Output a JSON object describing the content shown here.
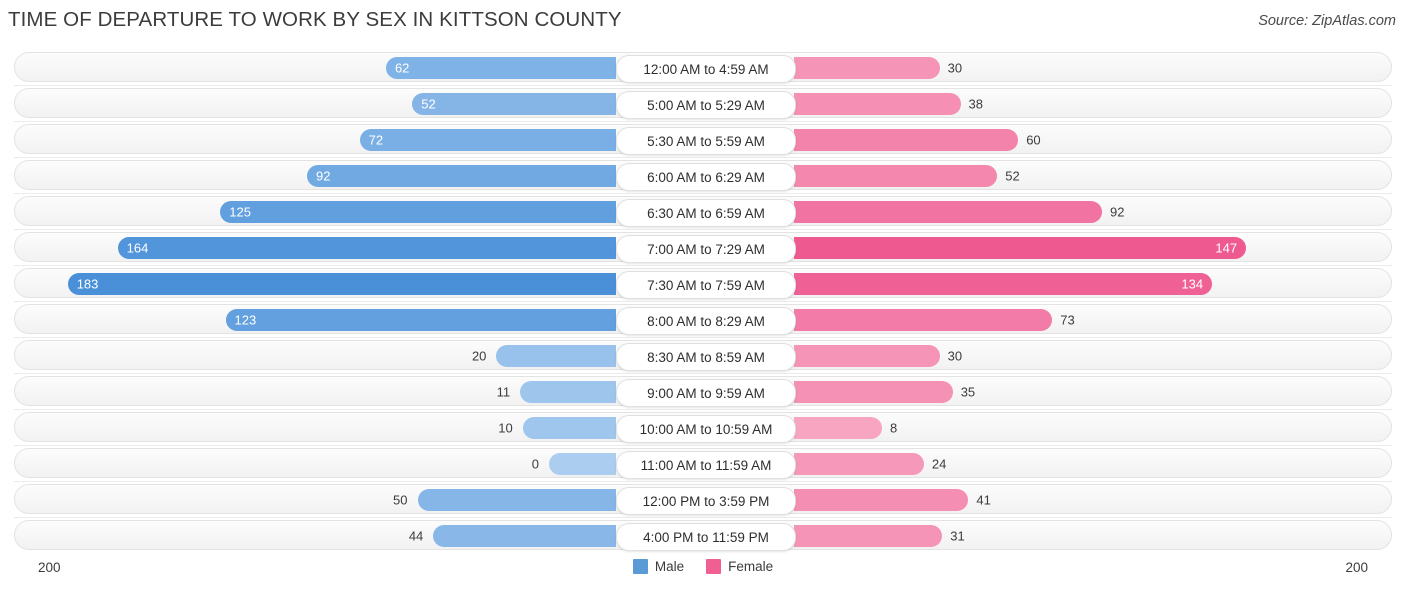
{
  "header": {
    "title": "TIME OF DEPARTURE TO WORK BY SEX IN KITTSON COUNTY",
    "source": "Source: ZipAtlas.com"
  },
  "legend": {
    "male_label": "Male",
    "female_label": "Female",
    "male_color": "#5b9bd5",
    "female_color": "#ef5f92"
  },
  "axis": {
    "left_max": "200",
    "right_max": "200"
  },
  "chart_data": {
    "type": "bar",
    "orientation": "diverging-horizontal",
    "title": "TIME OF DEPARTURE TO WORK BY SEX IN KITTSON COUNTY",
    "xlabel": "",
    "ylabel": "",
    "xlim": [
      200,
      200
    ],
    "grid": false,
    "legend_position": "bottom-center",
    "categories": [
      "12:00 AM to 4:59 AM",
      "5:00 AM to 5:29 AM",
      "5:30 AM to 5:59 AM",
      "6:00 AM to 6:29 AM",
      "6:30 AM to 6:59 AM",
      "7:00 AM to 7:29 AM",
      "7:30 AM to 7:59 AM",
      "8:00 AM to 8:29 AM",
      "8:30 AM to 8:59 AM",
      "9:00 AM to 9:59 AM",
      "10:00 AM to 10:59 AM",
      "11:00 AM to 11:59 AM",
      "12:00 PM to 3:59 PM",
      "4:00 PM to 11:59 PM"
    ],
    "series": [
      {
        "name": "Male",
        "color": "#5b9bd5",
        "values": [
          62,
          52,
          72,
          92,
          125,
          164,
          183,
          123,
          20,
          11,
          10,
          0,
          50,
          44
        ]
      },
      {
        "name": "Female",
        "color": "#ef5f92",
        "values": [
          30,
          38,
          60,
          52,
          92,
          147,
          134,
          73,
          30,
          35,
          8,
          24,
          41,
          31
        ]
      }
    ]
  }
}
